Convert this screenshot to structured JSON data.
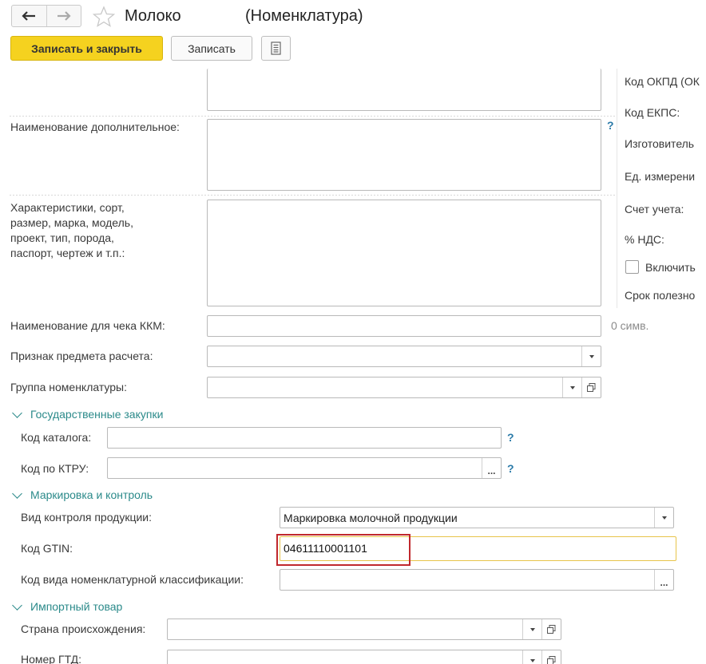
{
  "window": {
    "title": "Молоко",
    "subtitle": "(Номенклатура)"
  },
  "toolbar": {
    "save_close_label": "Записать и закрыть",
    "save_label": "Записать"
  },
  "fields": {
    "additional_name_label": "Наименование дополнительное:",
    "characteristics_label_1": "Характеристики, сорт,",
    "characteristics_label_2": "размер, марка, модель,",
    "characteristics_label_3": "проект, тип, порода,",
    "characteristics_label_4": "паспорт, чертеж и т.п.:",
    "receipt_name_label": "Наименование для чека ККМ:",
    "receipt_name_counter": "0 симв.",
    "payment_subject_label": "Признак предмета расчета:",
    "item_group_label": "Группа номенклатуры:"
  },
  "groups": {
    "procurement": {
      "title": "Государственные закупки",
      "catalog_code_label": "Код каталога:",
      "ktru_code_label": "Код по КТРУ:"
    },
    "marking": {
      "title": "Маркировка и контроль",
      "control_type_label": "Вид контроля продукции:",
      "control_type_value": "Маркировка молочной продукции",
      "gtin_label": "Код GTIN:",
      "gtin_value": "04611110001101",
      "classification_label": "Код вида номенклатурной классификации:"
    },
    "import": {
      "title": "Импортный товар",
      "country_label": "Страна происхождения:",
      "gtd_label": "Номер ГТД:"
    }
  },
  "right_panel": {
    "okpd_label": "Код ОКПД (ОК",
    "ekps_label": "Код ЕКПС:",
    "manufacturer_label": "Изготовитель",
    "unit_label": "Ед. измерени",
    "account_label": "Счет учета:",
    "vat_label": "% НДС:",
    "include_label": "Включить",
    "life_label": "Срок полезно"
  },
  "icons": {
    "help": "?",
    "dots": "..."
  },
  "colors": {
    "accent_yellow": "#f5d21f",
    "group_teal": "#2b8a8a",
    "highlight_red": "#c0282d",
    "focus_yellow": "#e7c44a"
  }
}
